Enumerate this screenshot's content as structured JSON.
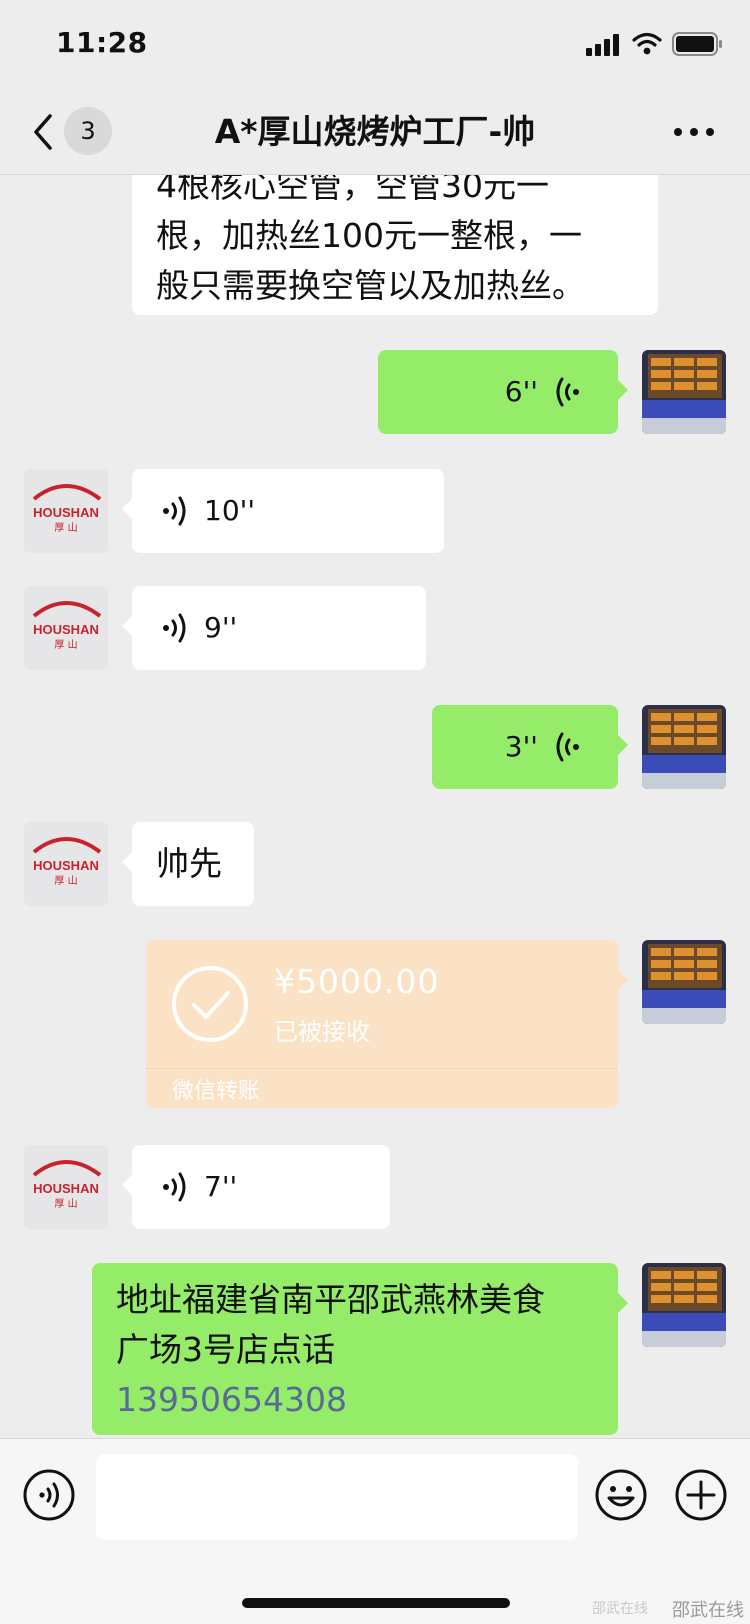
{
  "status_bar": {
    "time": "11:28"
  },
  "header": {
    "unread_count": "3",
    "title": "A*厚山烧烤炉工厂-帅"
  },
  "avatar_other": {
    "brand_en": "HOUSHAN",
    "brand_cn": "厚 山"
  },
  "messages": {
    "partial_text": {
      "line1": "4根核心空管，空管30元一",
      "line2": "根，加热丝100元一整根，一",
      "line3": "般只需要换空管以及加热丝。"
    },
    "voice_out_1": {
      "duration": "6''"
    },
    "voice_in_1": {
      "duration": "10''"
    },
    "voice_in_2": {
      "duration": "9''"
    },
    "voice_out_2": {
      "duration": "3''"
    },
    "text_in": {
      "text": "帅先"
    },
    "transfer": {
      "amount": "¥5000.00",
      "status": "已被接收",
      "brand": "微信转账"
    },
    "voice_in_3": {
      "duration": "7''"
    },
    "text_out": {
      "line1": "地址福建省南平邵武燕林美食",
      "line2": "广场3号店点话",
      "phone": "13950654308"
    }
  },
  "watermark": {
    "text": "邵武在线",
    "faint": "邵武在线"
  },
  "colors": {
    "outgoing_bubble": "#95ec69",
    "incoming_bubble": "#ffffff",
    "transfer_bubble": "#fce2c4",
    "phone_link": "#576b95"
  }
}
